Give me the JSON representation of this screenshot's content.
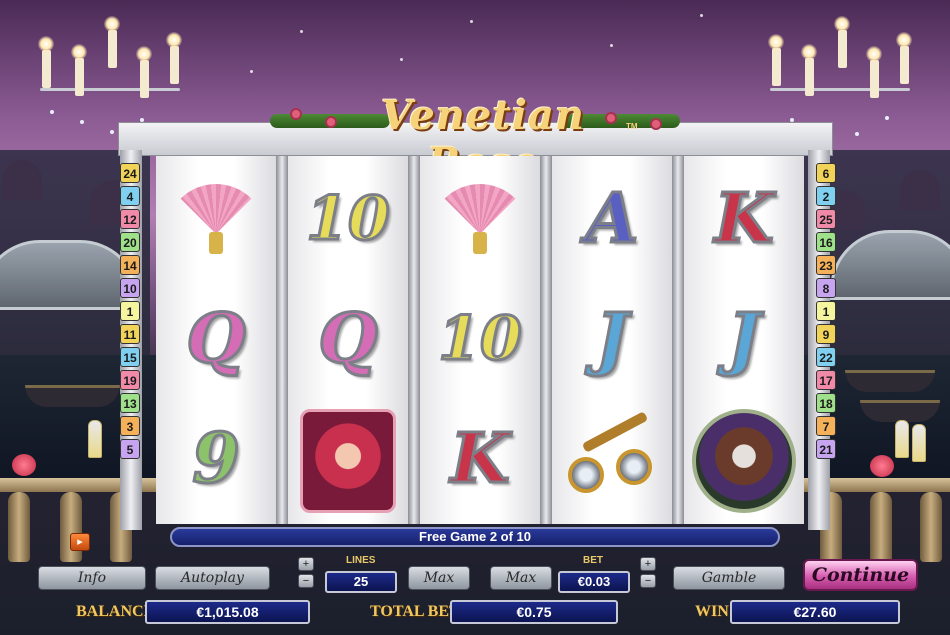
{
  "game": {
    "title": "Venetian Rose",
    "trademark": "TM",
    "status_text": "Free Game 2 of 10"
  },
  "reels": [
    [
      "fan",
      "Q",
      "9"
    ],
    [
      "10",
      "Q",
      "mask"
    ],
    [
      "fan",
      "10",
      "K"
    ],
    [
      "A",
      "J",
      "spyglass"
    ],
    [
      "K",
      "J",
      "doge"
    ]
  ],
  "paylines": {
    "left": [
      "24",
      "4",
      "12",
      "20",
      "14",
      "10",
      "1",
      "11",
      "15",
      "19",
      "13",
      "3",
      "5"
    ],
    "right": [
      "6",
      "2",
      "25",
      "16",
      "23",
      "8",
      "1",
      "9",
      "22",
      "17",
      "18",
      "7",
      "21"
    ]
  },
  "controls": {
    "info_label": "Info",
    "autoplay_label": "Autoplay",
    "lines_label": "LINES",
    "lines_value": "25",
    "max_lines_label": "Max",
    "max_bet_label": "Max",
    "bet_label": "BET",
    "bet_value": "€0.03",
    "gamble_label": "Gamble",
    "continue_label": "Continue",
    "plus": "+",
    "minus": "−"
  },
  "meters": {
    "balance_label": "BALANCE",
    "balance_value": "€1,015.08",
    "total_bet_label": "TOTAL BET",
    "total_bet_value": "€0.75",
    "win_label": "WIN",
    "win_value": "€27.60"
  },
  "colors": {
    "accent": "#d65cb0",
    "meter_bg": "#16206a",
    "gold": "#f0c860"
  }
}
